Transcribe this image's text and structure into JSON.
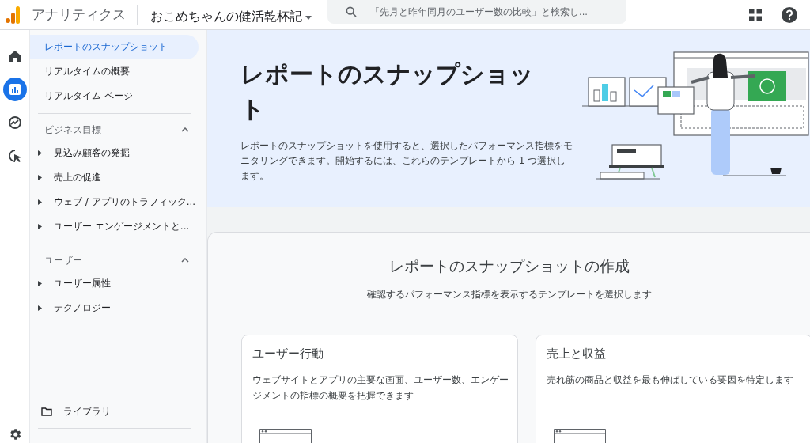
{
  "header": {
    "app_name": "アナリティクス",
    "property": "おこめちゃんの健活乾杯記",
    "search": {
      "placeholder": "「先月と昨年同月のユーザー数の比較」と検索し..."
    }
  },
  "rail": [
    {
      "selected": false
    },
    {
      "selected": true
    },
    {
      "selected": false
    },
    {
      "selected": false
    }
  ],
  "nav": {
    "top_items": [
      {
        "label": "レポートのスナップショット",
        "selected": true
      },
      {
        "label": "リアルタイムの概要",
        "selected": false
      },
      {
        "label": "リアルタイム ページ",
        "selected": false
      }
    ],
    "sections": [
      {
        "title": "ビジネス目標",
        "expanded": true,
        "items": [
          {
            "label": "見込み顧客の発掘",
            "expanded": false
          },
          {
            "label": "売上の促進",
            "expanded": false
          },
          {
            "label": "ウェブ / アプリのトラフィック...",
            "expanded": false
          },
          {
            "label": "ユーザー エンゲージメントと...",
            "expanded": false
          }
        ]
      },
      {
        "title": "ユーザー",
        "expanded": true,
        "items": [
          {
            "label": "ユーザー属性",
            "expanded": false
          },
          {
            "label": "テクノロジー",
            "expanded": false
          }
        ]
      }
    ],
    "library": "ライブラリ"
  },
  "hero": {
    "title": "レポートのスナップショット",
    "description": "レポートのスナップショットを使用すると、選択したパフォーマンス指標をモニタリングできます。開始するには、これらのテンプレートから 1 つ選択します。"
  },
  "create": {
    "title": "レポートのスナップショットの作成",
    "subtitle": "確認するパフォーマンス指標を表示するテンプレートを選択します",
    "cards": [
      {
        "title": "ユーザー行動",
        "description": "ウェブサイトとアプリの主要な画面、ユーザー数、エンゲージメントの指標の概要を把握できます"
      },
      {
        "title": "売上と収益",
        "description": "売れ筋の商品と収益を最も伸ばしている要因を特定します"
      }
    ]
  }
}
